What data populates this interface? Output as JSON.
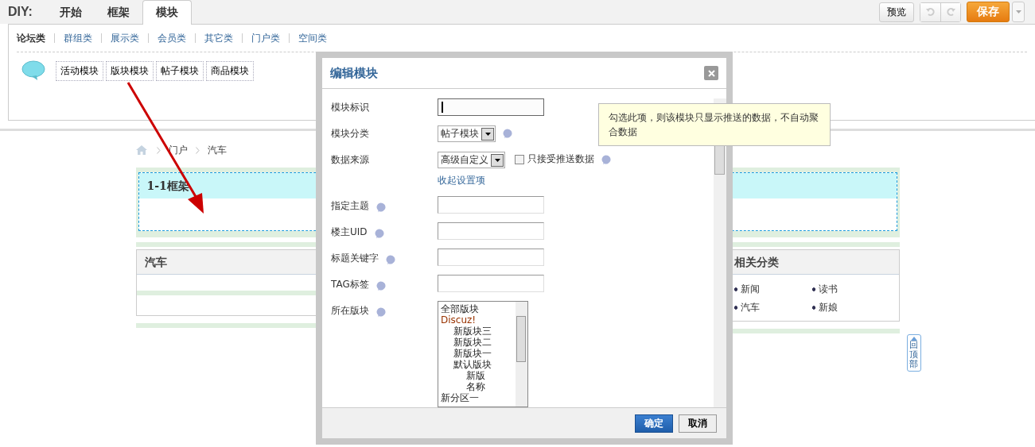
{
  "toolbar": {
    "brand": "DIY:",
    "tabs": [
      {
        "label": "开始",
        "selected": false
      },
      {
        "label": "框架",
        "selected": false
      },
      {
        "label": "模块",
        "selected": true
      }
    ],
    "preview_button": "预览",
    "save_button": "保存"
  },
  "categories": [
    {
      "label": "论坛类",
      "selected": true
    },
    {
      "label": "群组类",
      "selected": false
    },
    {
      "label": "展示类",
      "selected": false
    },
    {
      "label": "会员类",
      "selected": false
    },
    {
      "label": "其它类",
      "selected": false
    },
    {
      "label": "门户类",
      "selected": false
    },
    {
      "label": "空间类",
      "selected": false
    }
  ],
  "modules": [
    "活动模块",
    "版块模块",
    "帖子模块",
    "商品模块"
  ],
  "breadcrumb": [
    "门户",
    "汽车"
  ],
  "frame": {
    "title": "1-1框架"
  },
  "main_box": {
    "title": "汽车"
  },
  "side_box": {
    "title": "相关分类",
    "items": [
      "新闻",
      "读书",
      "汽车",
      "新娘"
    ]
  },
  "back_to_top": "回顶部",
  "dialog": {
    "title": "编辑模块",
    "fields": [
      {
        "kind": "input",
        "label": "模块标识",
        "focused": true
      },
      {
        "kind": "select",
        "label": "模块分类",
        "help": true,
        "value": "帖子模块"
      },
      {
        "kind": "source",
        "label": "数据来源",
        "help": true,
        "value": "高级自定义",
        "checkbox_label": "只接受推送数据",
        "checked": false
      },
      {
        "kind": "link",
        "label": "收起设置项"
      },
      {
        "kind": "input",
        "label": "指定主题",
        "help": true,
        "focused": false
      },
      {
        "kind": "input",
        "label": "楼主UID",
        "help": true,
        "focused": false
      },
      {
        "kind": "input",
        "label": "标题关键字",
        "help": true,
        "focused": false
      },
      {
        "kind": "input",
        "label": "TAG标签",
        "help": true,
        "focused": false
      },
      {
        "kind": "list",
        "label": "所在版块",
        "help": true
      }
    ],
    "forums": [
      {
        "label": "全部版块",
        "kind": "forum"
      },
      {
        "label": "Discuz!",
        "kind": "group",
        "children": [
          {
            "label": "新版块三",
            "kind": "forum"
          },
          {
            "label": "新版块二",
            "kind": "forum"
          },
          {
            "label": "新版块一",
            "kind": "forum"
          },
          {
            "label": "默认版块",
            "kind": "forum",
            "children": [
              {
                "label": "新版",
                "kind": "forum"
              },
              {
                "label": "名称",
                "kind": "forum"
              }
            ]
          }
        ]
      },
      {
        "label": "新分区一",
        "kind": "forum"
      }
    ],
    "tooltip": "勾选此项，则该模块只显示推送的数据，不自动聚合数据",
    "ok_button": "确定",
    "cancel_button": "取消"
  }
}
